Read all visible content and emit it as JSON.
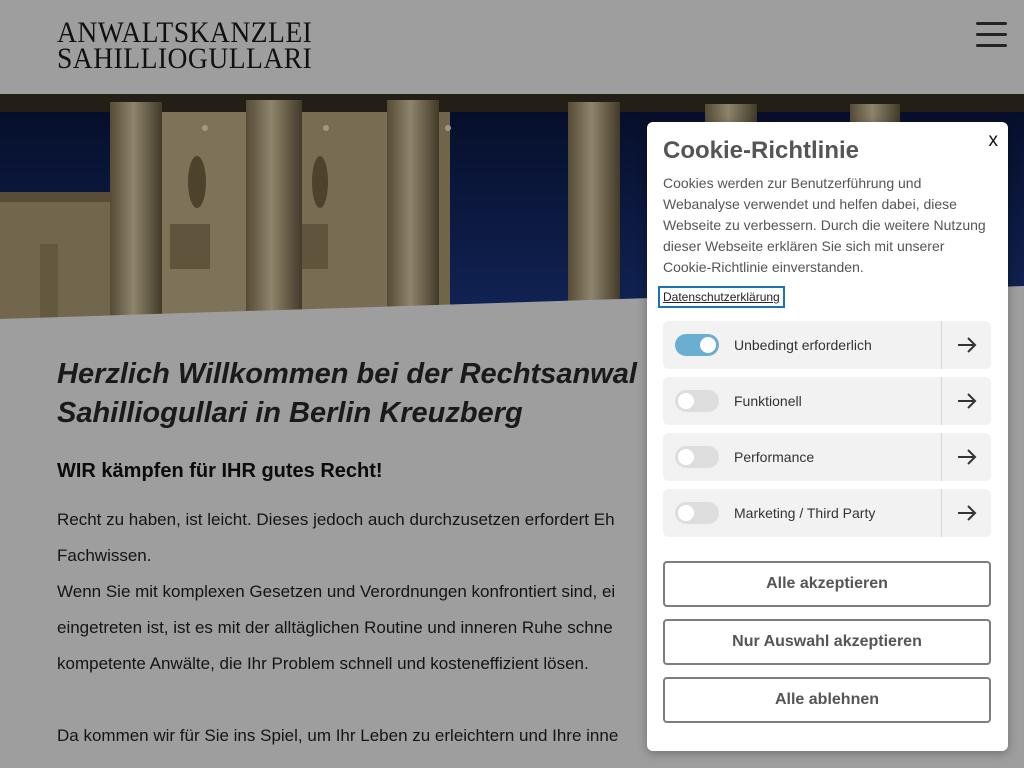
{
  "header": {
    "logo_line1": "ANWALTSKANZLEI",
    "logo_line2": "SAHILLIOGULLARI",
    "menu_icon": "hamburger-menu-icon"
  },
  "hero": {
    "image": "brandenburg-gate-night-photo",
    "colors": {
      "sky": "#0d1a45",
      "stone": "#d8c8a0"
    }
  },
  "main": {
    "headline_line1": "Herzlich Willkommen bei der Rechtsanwal",
    "headline_line2": "Sahilliogullari in Berlin Kreuzberg",
    "subhead": "WIR kämpfen für IHR gutes Recht!",
    "para_lines": [
      "Recht zu haben, ist leicht. Dieses jedoch auch durchzusetzen erfordert Eh",
      "Fachwissen.",
      "Wenn Sie mit komplexen Gesetzen und Verordnungen konfrontiert sind, ei",
      "eingetreten ist, ist es mit der alltäglichen Routine und inneren Ruhe schne",
      "kompetente Anwälte, die Ihr Problem schnell und kosteneffizient lösen."
    ],
    "para2": "Da kommen wir für Sie ins Spiel, um Ihr Leben zu erleichtern und Ihre inne"
  },
  "cookie": {
    "close_label": "x",
    "title": "Cookie-Richtlinie",
    "text": "Cookies werden zur Benutzerführung und Webanalyse verwendet und helfen dabei, diese Webseite zu verbessern. Durch die weitere Nutzung dieser Webseite erklären Sie sich mit unserer Cookie-Richtlinie einverstanden.",
    "privacy_link": "Datenschutzerklärung",
    "categories": [
      {
        "label": "Unbedingt erforderlich",
        "enabled": true
      },
      {
        "label": "Funktionell",
        "enabled": false
      },
      {
        "label": "Performance",
        "enabled": false
      },
      {
        "label": "Marketing / Third Party",
        "enabled": false
      }
    ],
    "buttons": {
      "accept_all": "Alle akzeptieren",
      "accept_selection": "Nur Auswahl akzeptieren",
      "reject_all": "Alle ablehnen"
    },
    "accent_color": "#6aaed1"
  }
}
